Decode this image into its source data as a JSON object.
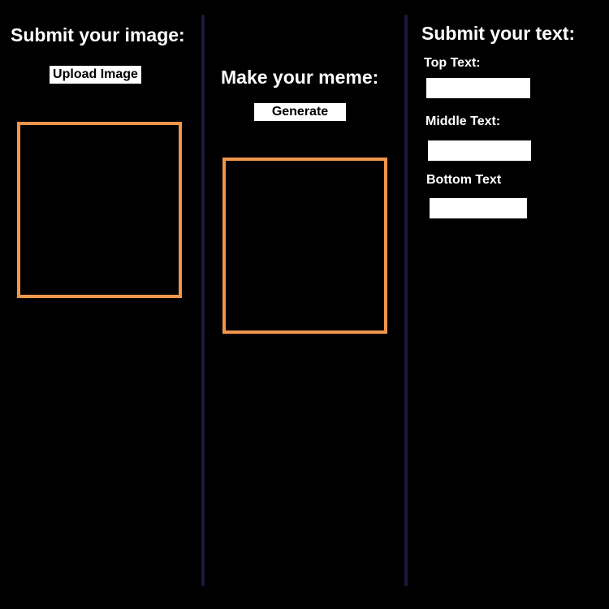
{
  "colors": {
    "background": "#000000",
    "divider": "#1a1a40",
    "frame_border": "#f0964a",
    "text": "#ffffff",
    "button_bg": "#ffffff",
    "button_text": "#000000"
  },
  "image_panel": {
    "heading": "Submit your image:",
    "upload_label": "Upload Image"
  },
  "meme_panel": {
    "heading": "Make your meme:",
    "generate_label": "Generate"
  },
  "text_panel": {
    "heading": "Submit your text:",
    "top_label": "Top Text:",
    "top_value": "",
    "middle_label": "Middle Text:",
    "middle_value": "",
    "bottom_label": "Bottom Text",
    "bottom_value": ""
  }
}
